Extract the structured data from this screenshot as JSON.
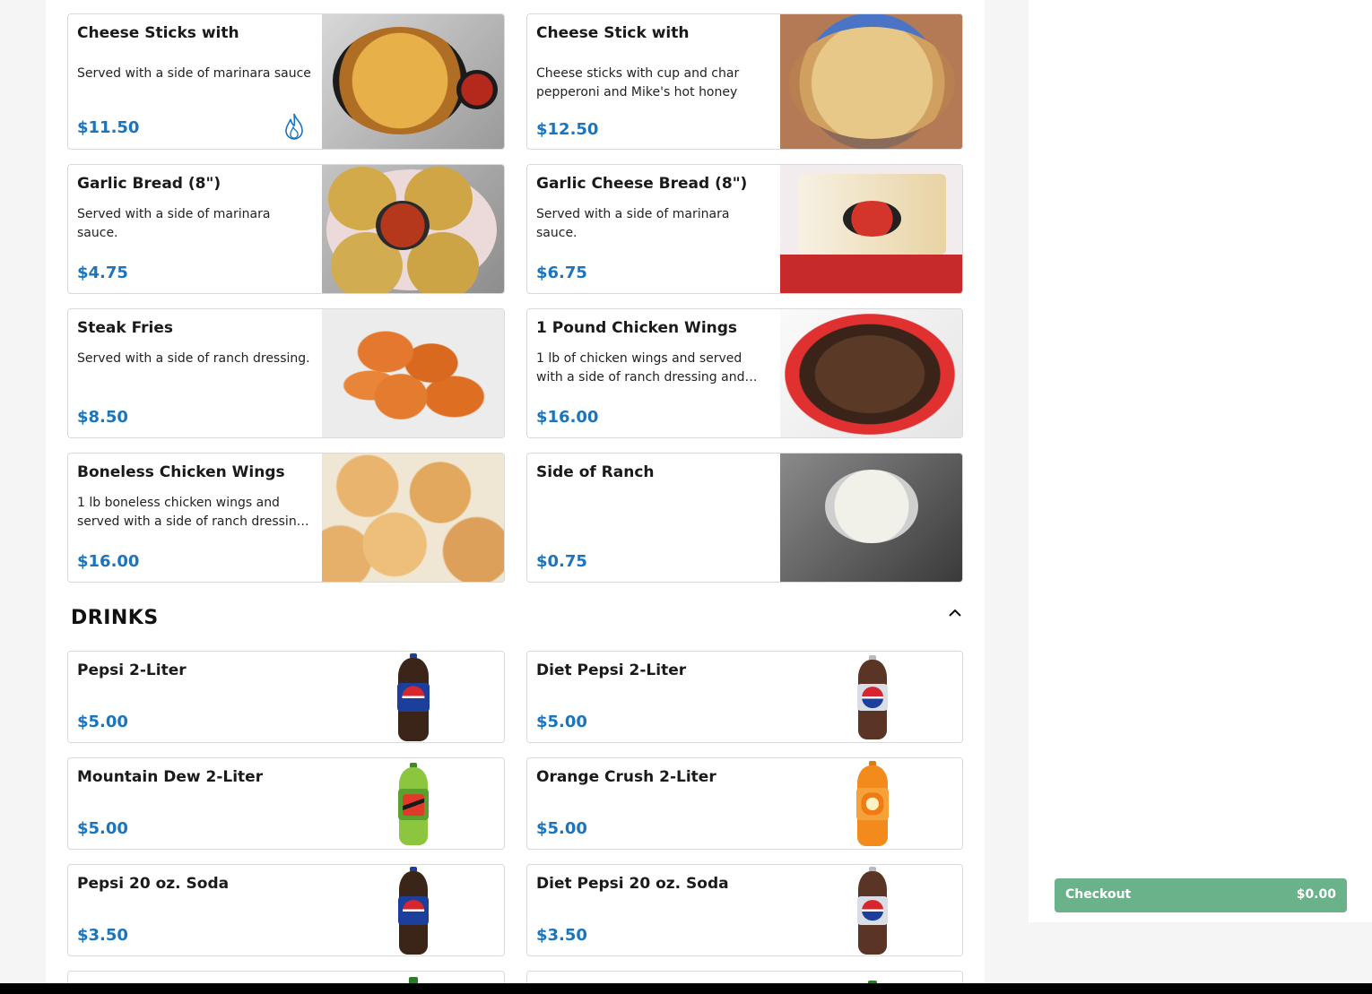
{
  "appetizers": [
    {
      "name": "Cheese Sticks with Jalapeños",
      "desc": "Served with a side of marinara sauce",
      "price": "$11.50",
      "image": "jalapeno-cheese-sticks",
      "spicy_icon": "flame-icon"
    },
    {
      "name": "Cheese Stick with Pepperoni",
      "desc": "Cheese sticks with cup and char pepperoni and Mike's hot honey",
      "price": "$12.50",
      "image": "pepperoni-cheese-sticks"
    },
    {
      "name": "Garlic Bread (8\")",
      "desc": "Served with a side of marinara sauce.",
      "price": "$4.75",
      "image": "garlic-bread"
    },
    {
      "name": "Garlic Cheese Bread (8\")",
      "desc": "Served with a side of marinara sauce.",
      "price": "$6.75",
      "image": "garlic-cheese-bread"
    },
    {
      "name": "Steak Fries",
      "desc": "Served with a side of ranch dressing.",
      "price": "$8.50",
      "image": "steak-fries"
    },
    {
      "name": "1 Pound Chicken Wings",
      "desc": "1 lb of chicken wings and served with a side of ranch dressing and…",
      "price": "$16.00",
      "image": "chicken-wings"
    },
    {
      "name": "Boneless Chicken Wings",
      "desc": "1 lb boneless chicken wings and served with a side of ranch dressin…",
      "price": "$16.00",
      "image": "boneless-wings"
    },
    {
      "name": "Side of Ranch",
      "desc": "",
      "price": "$0.75",
      "image": "ranch-cup"
    }
  ],
  "drinks_section": {
    "title": "DRINKS",
    "toggle_icon": "chevron-up-icon"
  },
  "drinks": [
    {
      "name": "Pepsi 2-Liter",
      "price": "$5.00",
      "image": "pepsi-bottle"
    },
    {
      "name": "Diet Pepsi 2-Liter",
      "price": "$5.00",
      "image": "diet-pepsi-bottle"
    },
    {
      "name": "Mountain Dew 2-Liter",
      "price": "$5.00",
      "image": "mountain-dew-bottle"
    },
    {
      "name": "Orange Crush 2-Liter",
      "price": "$5.00",
      "image": "orange-crush-bottle"
    },
    {
      "name": "Pepsi 20 oz. Soda",
      "price": "$3.50",
      "image": "pepsi-bottle"
    },
    {
      "name": "Diet Pepsi 20 oz. Soda",
      "price": "$3.50",
      "image": "diet-pepsi-bottle"
    }
  ],
  "cart": {
    "checkout_label": "Checkout",
    "total": "$0.00"
  },
  "colors": {
    "price": "#1c75bc",
    "checkout": "#6ab38a",
    "border": "#d9d9d9"
  }
}
